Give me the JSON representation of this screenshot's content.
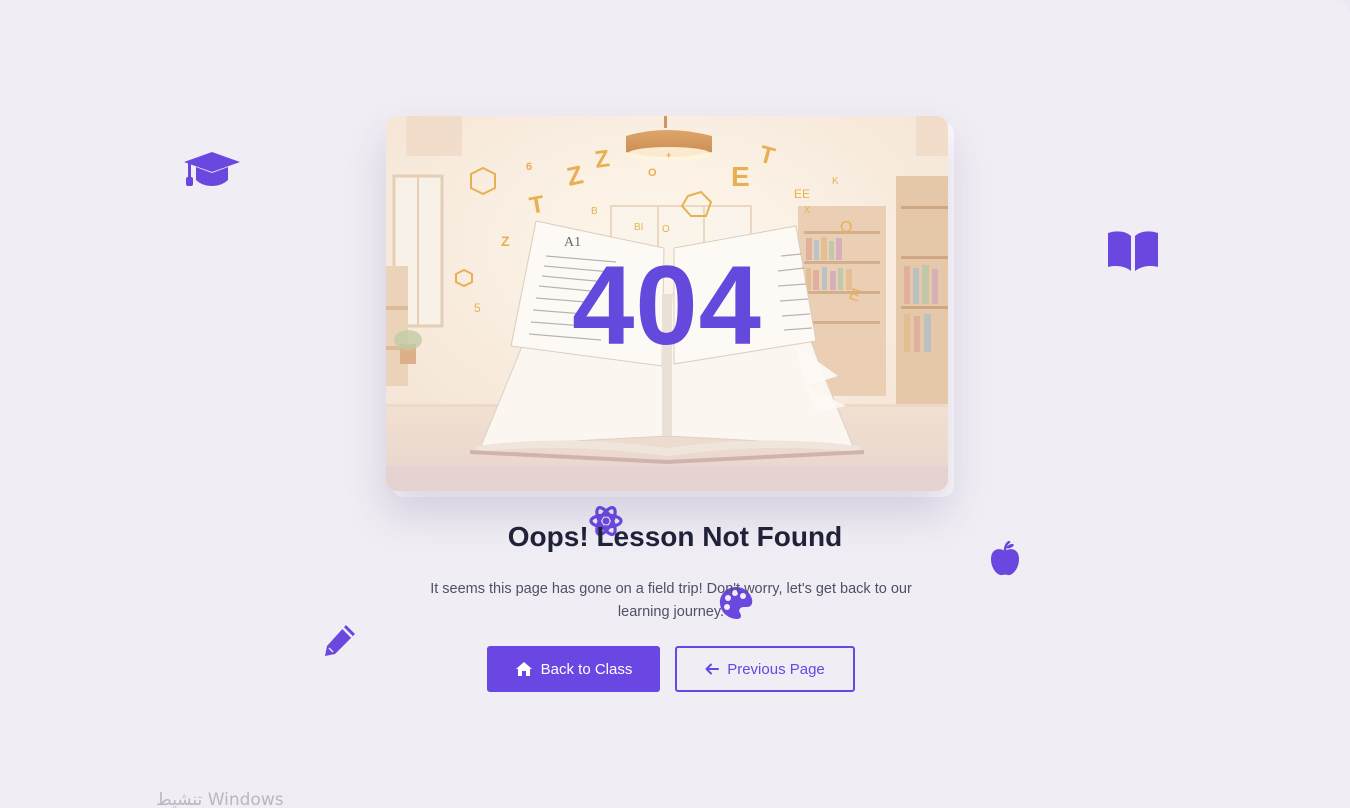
{
  "hero": {
    "code": "404"
  },
  "content": {
    "title": "Oops! Lesson Not Found",
    "message": "It seems this page has gone on a field trip! Don't worry, let's get back to our learning journey."
  },
  "actions": {
    "home_label": "Back to Class",
    "back_label": "Previous Page"
  },
  "decorations": {
    "icons": [
      "graduation-cap-icon",
      "open-book-icon",
      "atom-icon",
      "apple-icon",
      "palette-icon",
      "pencil-icon"
    ],
    "accent_color": "#6a46e2"
  },
  "system": {
    "watermark": "تنشيط Windows"
  }
}
